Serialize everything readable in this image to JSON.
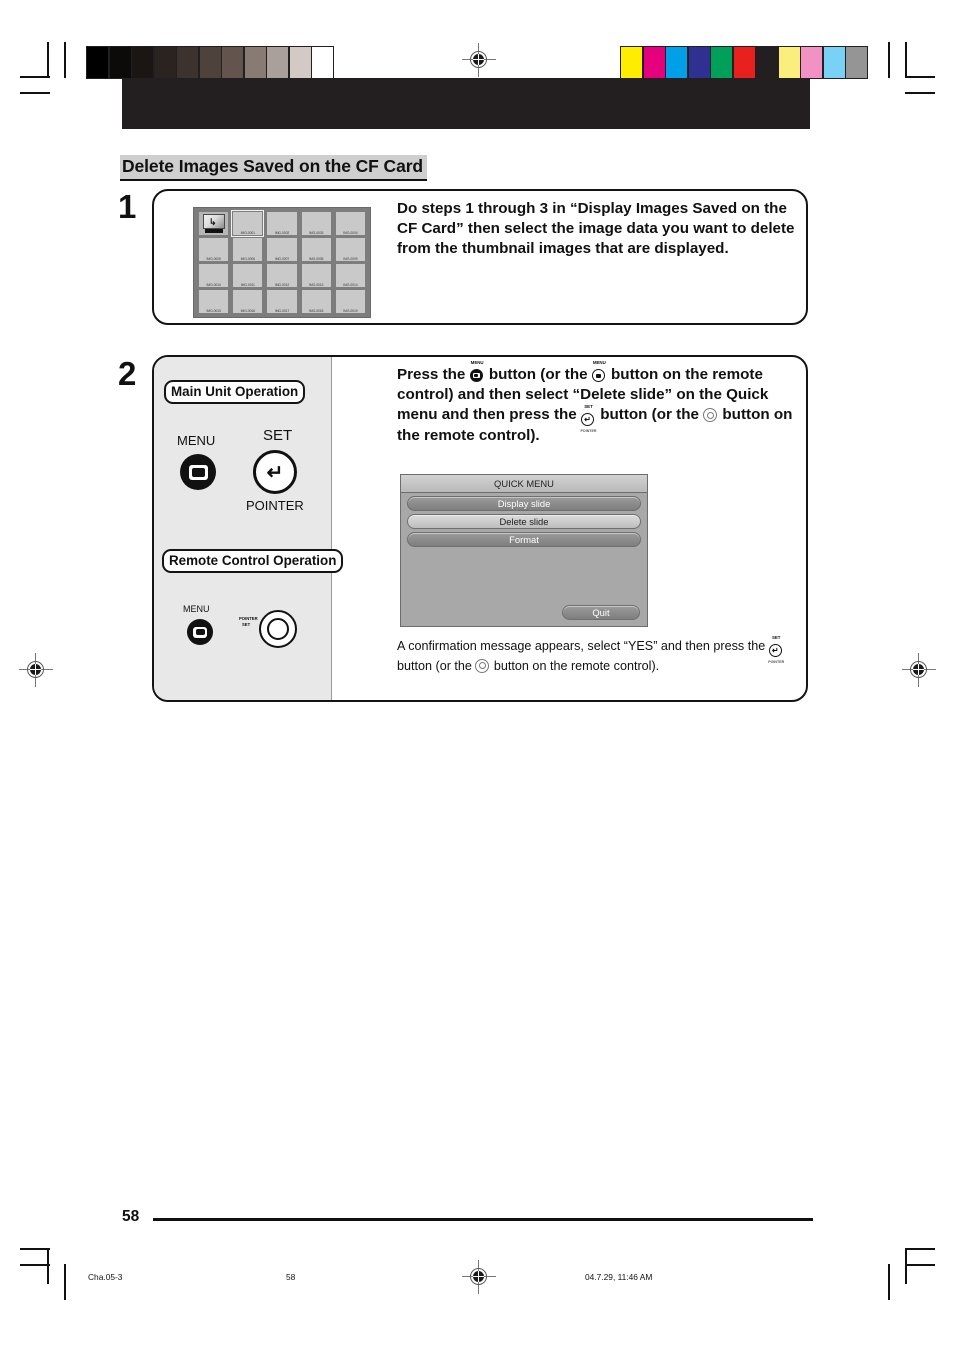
{
  "document": {
    "section_heading": "Delete Images Saved on the CF Card",
    "page_number": "58"
  },
  "footer": {
    "file_label": "Cha.05-3",
    "page_label": "58",
    "timestamp": "04.7.29, 11:46 AM"
  },
  "steps": [
    {
      "number": "1",
      "text": "Do steps 1 through 3 in “Display Images Saved on the CF Card” then select the image data you want to delete from the thumbnail images that are displayed."
    },
    {
      "number": "2",
      "text_parts": {
        "p1": "Press the",
        "p2": "button (or the",
        "p3": "button on the remote control) and then select “Delete slide” on the Quick menu and then press the",
        "p4": "button (or the",
        "p5": "button on the remote control)."
      },
      "note_parts": {
        "n1": "A confirmation message appears, select “YES” and then press the",
        "n2": "button (or the",
        "n3": "button on the remote control)."
      }
    }
  ],
  "thumbnail_screen": {
    "up_dir_icon": "folder-up-icon",
    "rows": [
      [
        "",
        "IMG-0001",
        "IMG-0002",
        "IMG-0003",
        "IMG-0004"
      ],
      [
        "IMG-0005",
        "IMG-0006",
        "IMG-0007",
        "IMG-0008",
        "IMG-0009"
      ],
      [
        "IMG-0010",
        "IMG-0011",
        "IMG-0012",
        "IMG-0013",
        "IMG-0014"
      ],
      [
        "IMG-0015",
        "IMG-0016",
        "IMG-0017",
        "IMG-0018",
        "IMG-0019"
      ]
    ],
    "selected_index": 1
  },
  "device_panel": {
    "main_unit_label": "Main Unit Operation",
    "remote_label": "Remote Control Operation",
    "main_menu_caption": "MENU",
    "main_set_caption": "SET",
    "main_pointer_caption": "POINTER",
    "remote_menu_caption": "MENU",
    "remote_set_caption_top": "POINTER",
    "remote_set_caption_bottom": "SET"
  },
  "glyph_labels": {
    "menu": "MENU",
    "set": "SET",
    "pointer": "POINTER"
  },
  "quick_menu": {
    "title": "QUICK MENU",
    "items": [
      {
        "label": "Display slide",
        "highlighted": false
      },
      {
        "label": "Delete slide",
        "highlighted": true
      },
      {
        "label": "Format",
        "highlighted": false
      }
    ],
    "quit_label": "Quit"
  },
  "print_marks": {
    "grayscale_wedge": [
      "#000000",
      "#0d0a0a",
      "#1b1614",
      "#2b2320",
      "#3d332e",
      "#4e423c",
      "#63554e",
      "#877b74",
      "#a9a09a",
      "#d3c9c5",
      "#ffffff"
    ],
    "color_bars": [
      "#ffed00",
      "#e5007e",
      "#00a0e9",
      "#2e3192",
      "#00a05a",
      "#e8201e",
      "#231f20",
      "#faee7d",
      "#f291c4",
      "#79d2f5",
      "#959595"
    ]
  }
}
